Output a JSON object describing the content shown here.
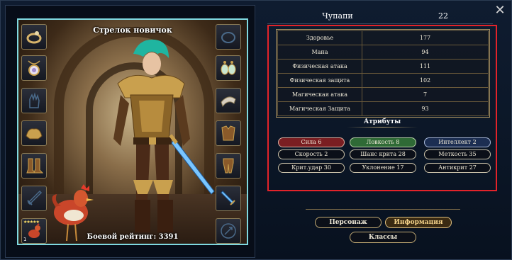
{
  "character": {
    "class_title": "Стрелок новичок",
    "rating_label": "Боевой рейтинг: 3391",
    "name": "Чупапи",
    "level": "22"
  },
  "equipment": {
    "left_slots": [
      "ring-icon",
      "amulet-icon",
      "gloves-icon",
      "shoulder-armor-icon",
      "boots-icon",
      "sword-icon",
      "pet-rooster-icon"
    ],
    "right_slots": [
      "ring-icon",
      "earrings-icon",
      "bracelet-icon",
      "chest-armor-icon",
      "leg-armor-icon",
      "dagger-icon",
      "skill-icon"
    ],
    "pet_stars": "★★★★★",
    "pet_level": "1"
  },
  "stats": [
    {
      "label": "Здоровье",
      "value": "177"
    },
    {
      "label": "Мана",
      "value": "94"
    },
    {
      "label": "Физическая атака",
      "value": "111"
    },
    {
      "label": "Физическая защита",
      "value": "102"
    },
    {
      "label": "Магическая атака",
      "value": "7"
    },
    {
      "label": "Магическая Защита",
      "value": "93"
    }
  ],
  "attributes": {
    "title": "Атрибуты",
    "items": [
      {
        "label": "Сила 6",
        "color": "#7a1e22"
      },
      {
        "label": "Ловкость 8",
        "color": "#2f6a36"
      },
      {
        "label": "Интеллект 2",
        "color": "#1c2e52"
      },
      {
        "label": "Скорость 2"
      },
      {
        "label": "Шанс крита 28"
      },
      {
        "label": "Меткость 35"
      },
      {
        "label": "Крит.удар 30"
      },
      {
        "label": "Уклонение 17"
      },
      {
        "label": "Антикрит 27"
      }
    ]
  },
  "nav": {
    "character": "Персонаж",
    "info": "Информация",
    "classes": "Классы"
  },
  "colors": {
    "highlight": "#e3232a",
    "scene_border": "#7fd9e0"
  }
}
